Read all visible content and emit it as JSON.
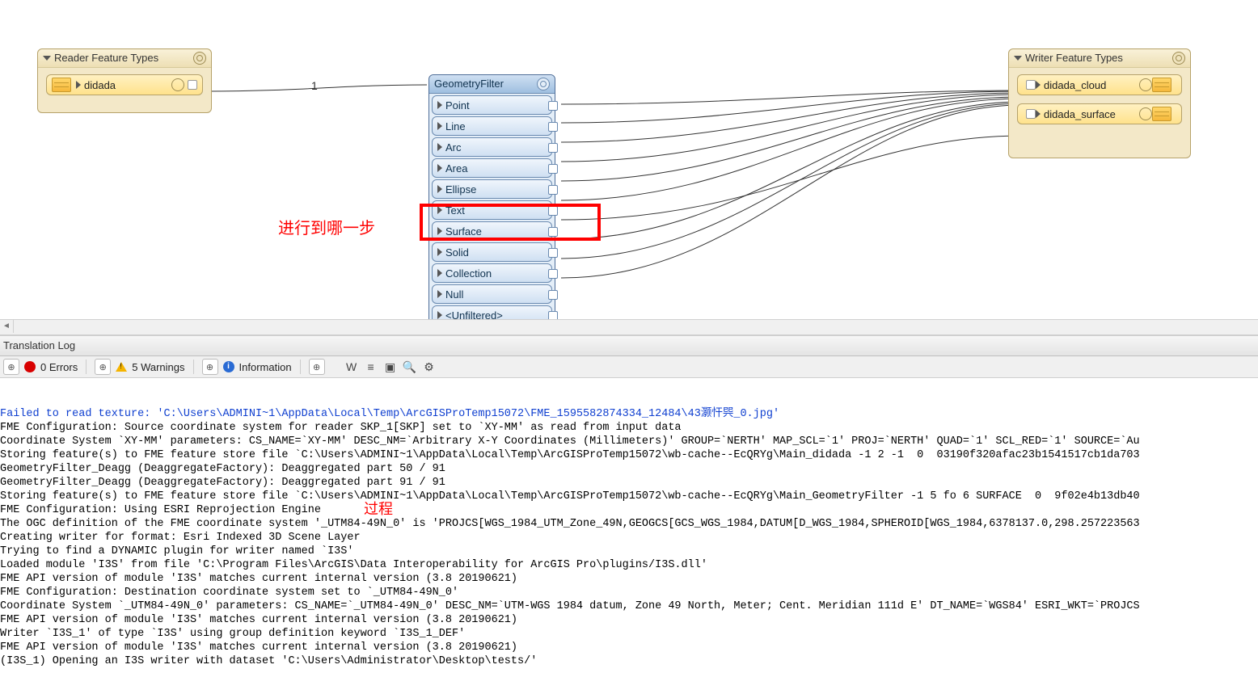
{
  "canvas": {
    "reader_group": {
      "title": "Reader Feature Types"
    },
    "reader_items": [
      {
        "label": "didada"
      }
    ],
    "writer_group": {
      "title": "Writer Feature Types"
    },
    "writer_items": [
      {
        "label": "didada_cloud"
      },
      {
        "label": "didada_surface"
      }
    ],
    "transformer": {
      "title": "GeometryFilter",
      "ports": [
        "Point",
        "Line",
        "Arc",
        "Area",
        "Ellipse",
        "Text",
        "Surface",
        "Solid",
        "Collection",
        "Null",
        "<Unfiltered>"
      ]
    },
    "edge_label": "1",
    "annotation": "进行到哪一步"
  },
  "log": {
    "title": "Translation Log",
    "errors": "0 Errors",
    "warnings": "5 Warnings",
    "info": "Information",
    "over_annotation": "过程",
    "lines": [
      {
        "class": "blue",
        "text": "Failed to read texture: 'C:\\Users\\ADMINI~1\\AppData\\Local\\Temp\\ArcGISProTemp15072\\FME_1595582874334_12484\\43灏忓巺_0.jpg'"
      },
      {
        "class": "",
        "text": "FME Configuration: Source coordinate system for reader SKP_1[SKP] set to `XY-MM' as read from input data"
      },
      {
        "class": "",
        "text": "Coordinate System `XY-MM' parameters: CS_NAME=`XY-MM' DESC_NM=`Arbitrary X-Y Coordinates (Millimeters)' GROUP=`NERTH' MAP_SCL=`1' PROJ=`NERTH' QUAD=`1' SCL_RED=`1' SOURCE=`Au"
      },
      {
        "class": "",
        "text": "Storing feature(s) to FME feature store file `C:\\Users\\ADMINI~1\\AppData\\Local\\Temp\\ArcGISProTemp15072\\wb-cache--EcQRYg\\Main_didada -1 2 -1  0  03190f320afac23b1541517cb1da703"
      },
      {
        "class": "",
        "text": "GeometryFilter_Deagg (DeaggregateFactory): Deaggregated part 50 / 91"
      },
      {
        "class": "",
        "text": "GeometryFilter_Deagg (DeaggregateFactory): Deaggregated part 91 / 91"
      },
      {
        "class": "",
        "text": "Storing feature(s) to FME feature store file `C:\\Users\\ADMINI~1\\AppData\\Local\\Temp\\ArcGISProTemp15072\\wb-cache--EcQRYg\\Main_GeometryFilter -1 5 fo 6 SURFACE  0  9f02e4b13db40"
      },
      {
        "class": "",
        "text": "FME Configuration: Using ESRI Reprojection Engine"
      },
      {
        "class": "",
        "text": "The OGC definition of the FME coordinate system '_UTM84-49N_0' is 'PROJCS[WGS_1984_UTM_Zone_49N,GEOGCS[GCS_WGS_1984,DATUM[D_WGS_1984,SPHEROID[WGS_1984,6378137.0,298.257223563"
      },
      {
        "class": "",
        "text": "Creating writer for format: Esri Indexed 3D Scene Layer"
      },
      {
        "class": "",
        "text": "Trying to find a DYNAMIC plugin for writer named `I3S'"
      },
      {
        "class": "",
        "text": "Loaded module 'I3S' from file 'C:\\Program Files\\ArcGIS\\Data Interoperability for ArcGIS Pro\\plugins/I3S.dll'"
      },
      {
        "class": "",
        "text": "FME API version of module 'I3S' matches current internal version (3.8 20190621)"
      },
      {
        "class": "",
        "text": "FME Configuration: Destination coordinate system set to `_UTM84-49N_0'"
      },
      {
        "class": "",
        "text": "Coordinate System `_UTM84-49N_0' parameters: CS_NAME=`_UTM84-49N_0' DESC_NM=`UTM-WGS 1984 datum, Zone 49 North, Meter; Cent. Meridian 111d E' DT_NAME=`WGS84' ESRI_WKT=`PROJCS"
      },
      {
        "class": "",
        "text": "FME API version of module 'I3S' matches current internal version (3.8 20190621)"
      },
      {
        "class": "",
        "text": "Writer `I3S_1' of type `I3S' using group definition keyword `I3S_1_DEF'"
      },
      {
        "class": "",
        "text": "FME API version of module 'I3S' matches current internal version (3.8 20190621)"
      },
      {
        "class": "",
        "text": "(I3S_1) Opening an I3S writer with dataset 'C:\\Users\\Administrator\\Desktop\\tests/'"
      }
    ]
  }
}
